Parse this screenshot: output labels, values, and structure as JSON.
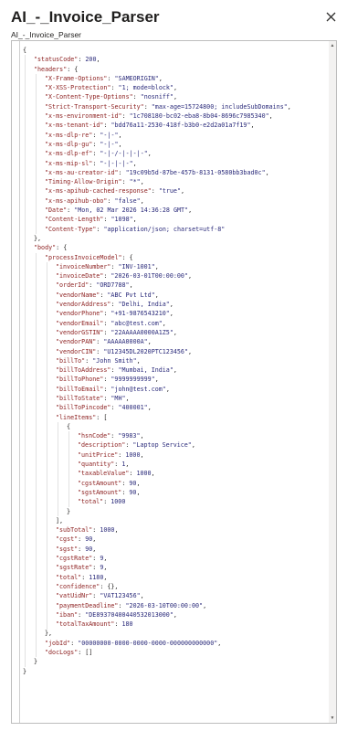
{
  "header": {
    "title": "AI_-_Invoice_Parser",
    "subtitle": "AI_-_Invoice_Parser",
    "close_icon": "close-icon"
  },
  "code_lines": [
    {
      "indent": 0,
      "t": [
        [
          "p",
          "{"
        ]
      ]
    },
    {
      "indent": 1,
      "t": [
        [
          "k",
          "\"statusCode\""
        ],
        [
          "p",
          ": "
        ],
        [
          "n",
          "200"
        ],
        [
          "p",
          ","
        ]
      ]
    },
    {
      "indent": 1,
      "t": [
        [
          "k",
          "\"headers\""
        ],
        [
          "p",
          ": {"
        ]
      ]
    },
    {
      "indent": 2,
      "t": [
        [
          "k",
          "\"X-Frame-Options\""
        ],
        [
          "p",
          ": "
        ],
        [
          "s",
          "\"SAMEORIGIN\""
        ],
        [
          "p",
          ","
        ]
      ]
    },
    {
      "indent": 2,
      "t": [
        [
          "k",
          "\"X-XSS-Protection\""
        ],
        [
          "p",
          ": "
        ],
        [
          "s",
          "\"1; mode=block\""
        ],
        [
          "p",
          ","
        ]
      ]
    },
    {
      "indent": 2,
      "t": [
        [
          "k",
          "\"X-Content-Type-Options\""
        ],
        [
          "p",
          ": "
        ],
        [
          "s",
          "\"nosniff\""
        ],
        [
          "p",
          ","
        ]
      ]
    },
    {
      "indent": 2,
      "t": [
        [
          "k",
          "\"Strict-Transport-Security\""
        ],
        [
          "p",
          ": "
        ],
        [
          "s",
          "\"max-age=15724800; includeSubDomains\""
        ],
        [
          "p",
          ","
        ]
      ]
    },
    {
      "indent": 2,
      "t": [
        [
          "k",
          "\"x-ms-environment-id\""
        ],
        [
          "p",
          ": "
        ],
        [
          "s",
          "\"1c708180-bc02-eba8-8b04-8696c7985340\""
        ],
        [
          "p",
          ","
        ]
      ]
    },
    {
      "indent": 2,
      "t": [
        [
          "k",
          "\"x-ms-tenant-id\""
        ],
        [
          "p",
          ": "
        ],
        [
          "s",
          "\"bdd76a11-2530-418f-b3b0-e2d2a01a7f19\""
        ],
        [
          "p",
          ","
        ]
      ]
    },
    {
      "indent": 2,
      "t": [
        [
          "k",
          "\"x-ms-dlp-re\""
        ],
        [
          "p",
          ": "
        ],
        [
          "s",
          "\"-|-\""
        ],
        [
          "p",
          ","
        ]
      ]
    },
    {
      "indent": 2,
      "t": [
        [
          "k",
          "\"x-ms-dlp-gu\""
        ],
        [
          "p",
          ": "
        ],
        [
          "s",
          "\"-|-\""
        ],
        [
          "p",
          ","
        ]
      ]
    },
    {
      "indent": 2,
      "t": [
        [
          "k",
          "\"x-ms-dlp-ef\""
        ],
        [
          "p",
          ": "
        ],
        [
          "s",
          "\"-|-/-|-|-|-\""
        ],
        [
          "p",
          ","
        ]
      ]
    },
    {
      "indent": 2,
      "t": [
        [
          "k",
          "\"x-ms-mip-sl\""
        ],
        [
          "p",
          ": "
        ],
        [
          "s",
          "\"-|-|-|-\""
        ],
        [
          "p",
          ","
        ]
      ]
    },
    {
      "indent": 2,
      "t": [
        [
          "k",
          "\"x-ms-au-creator-id\""
        ],
        [
          "p",
          ": "
        ],
        [
          "s",
          "\"19c09b5d-87be-457b-8131-0580bb3bad0c\""
        ],
        [
          "p",
          ","
        ]
      ]
    },
    {
      "indent": 2,
      "t": [
        [
          "k",
          "\"Timing-Allow-Origin\""
        ],
        [
          "p",
          ": "
        ],
        [
          "s",
          "\"*\""
        ],
        [
          "p",
          ","
        ]
      ]
    },
    {
      "indent": 2,
      "t": [
        [
          "k",
          "\"x-ms-apihub-cached-response\""
        ],
        [
          "p",
          ": "
        ],
        [
          "s",
          "\"true\""
        ],
        [
          "p",
          ","
        ]
      ]
    },
    {
      "indent": 2,
      "t": [
        [
          "k",
          "\"x-ms-apihub-obo\""
        ],
        [
          "p",
          ": "
        ],
        [
          "s",
          "\"false\""
        ],
        [
          "p",
          ","
        ]
      ]
    },
    {
      "indent": 2,
      "t": [
        [
          "k",
          "\"Date\""
        ],
        [
          "p",
          ": "
        ],
        [
          "s",
          "\"Mon, 02 Mar 2026 14:36:28 GMT\""
        ],
        [
          "p",
          ","
        ]
      ]
    },
    {
      "indent": 2,
      "t": [
        [
          "k",
          "\"Content-Length\""
        ],
        [
          "p",
          ": "
        ],
        [
          "s",
          "\"1098\""
        ],
        [
          "p",
          ","
        ]
      ]
    },
    {
      "indent": 2,
      "t": [
        [
          "k",
          "\"Content-Type\""
        ],
        [
          "p",
          ": "
        ],
        [
          "s",
          "\"application/json; charset=utf-8\""
        ]
      ]
    },
    {
      "indent": 1,
      "t": [
        [
          "p",
          "},"
        ]
      ]
    },
    {
      "indent": 1,
      "t": [
        [
          "k",
          "\"body\""
        ],
        [
          "p",
          ": {"
        ]
      ]
    },
    {
      "indent": 2,
      "t": [
        [
          "k",
          "\"processInvoiceModel\""
        ],
        [
          "p",
          ": {"
        ]
      ]
    },
    {
      "indent": 3,
      "t": [
        [
          "k",
          "\"invoiceNumber\""
        ],
        [
          "p",
          ": "
        ],
        [
          "s",
          "\"INV-1001\""
        ],
        [
          "p",
          ","
        ]
      ]
    },
    {
      "indent": 3,
      "t": [
        [
          "k",
          "\"invoiceDate\""
        ],
        [
          "p",
          ": "
        ],
        [
          "s",
          "\"2026-03-01T00:00:00\""
        ],
        [
          "p",
          ","
        ]
      ]
    },
    {
      "indent": 3,
      "t": [
        [
          "k",
          "\"orderId\""
        ],
        [
          "p",
          ": "
        ],
        [
          "s",
          "\"ORD7788\""
        ],
        [
          "p",
          ","
        ]
      ]
    },
    {
      "indent": 3,
      "t": [
        [
          "k",
          "\"vendorName\""
        ],
        [
          "p",
          ": "
        ],
        [
          "s",
          "\"ABC Pvt Ltd\""
        ],
        [
          "p",
          ","
        ]
      ]
    },
    {
      "indent": 3,
      "t": [
        [
          "k",
          "\"vendorAddress\""
        ],
        [
          "p",
          ": "
        ],
        [
          "s",
          "\"Delhi, India\""
        ],
        [
          "p",
          ","
        ]
      ]
    },
    {
      "indent": 3,
      "t": [
        [
          "k",
          "\"vendorPhone\""
        ],
        [
          "p",
          ": "
        ],
        [
          "s",
          "\"+91-9876543210\""
        ],
        [
          "p",
          ","
        ]
      ]
    },
    {
      "indent": 3,
      "t": [
        [
          "k",
          "\"vendorEmail\""
        ],
        [
          "p",
          ": "
        ],
        [
          "s",
          "\"abc@test.com\""
        ],
        [
          "p",
          ","
        ]
      ]
    },
    {
      "indent": 3,
      "t": [
        [
          "k",
          "\"vendorGSTIN\""
        ],
        [
          "p",
          ": "
        ],
        [
          "s",
          "\"22AAAAA0000A1Z5\""
        ],
        [
          "p",
          ","
        ]
      ]
    },
    {
      "indent": 3,
      "t": [
        [
          "k",
          "\"vendorPAN\""
        ],
        [
          "p",
          ": "
        ],
        [
          "s",
          "\"AAAAA0000A\""
        ],
        [
          "p",
          ","
        ]
      ]
    },
    {
      "indent": 3,
      "t": [
        [
          "k",
          "\"vendorCIN\""
        ],
        [
          "p",
          ": "
        ],
        [
          "s",
          "\"U12345DL2020PTC123456\""
        ],
        [
          "p",
          ","
        ]
      ]
    },
    {
      "indent": 3,
      "t": [
        [
          "k",
          "\"billTo\""
        ],
        [
          "p",
          ": "
        ],
        [
          "s",
          "\"John Smith\""
        ],
        [
          "p",
          ","
        ]
      ]
    },
    {
      "indent": 3,
      "t": [
        [
          "k",
          "\"billToAddress\""
        ],
        [
          "p",
          ": "
        ],
        [
          "s",
          "\"Mumbai, India\""
        ],
        [
          "p",
          ","
        ]
      ]
    },
    {
      "indent": 3,
      "t": [
        [
          "k",
          "\"billToPhone\""
        ],
        [
          "p",
          ": "
        ],
        [
          "s",
          "\"9999999999\""
        ],
        [
          "p",
          ","
        ]
      ]
    },
    {
      "indent": 3,
      "t": [
        [
          "k",
          "\"billToEmail\""
        ],
        [
          "p",
          ": "
        ],
        [
          "s",
          "\"john@test.com\""
        ],
        [
          "p",
          ","
        ]
      ]
    },
    {
      "indent": 3,
      "t": [
        [
          "k",
          "\"billToState\""
        ],
        [
          "p",
          ": "
        ],
        [
          "s",
          "\"MH\""
        ],
        [
          "p",
          ","
        ]
      ]
    },
    {
      "indent": 3,
      "t": [
        [
          "k",
          "\"billToPincode\""
        ],
        [
          "p",
          ": "
        ],
        [
          "s",
          "\"400001\""
        ],
        [
          "p",
          ","
        ]
      ]
    },
    {
      "indent": 3,
      "t": [
        [
          "k",
          "\"lineItems\""
        ],
        [
          "p",
          ": ["
        ]
      ]
    },
    {
      "indent": 4,
      "t": [
        [
          "p",
          "{"
        ]
      ]
    },
    {
      "indent": 5,
      "t": [
        [
          "k",
          "\"hsnCode\""
        ],
        [
          "p",
          ": "
        ],
        [
          "s",
          "\"9983\""
        ],
        [
          "p",
          ","
        ]
      ]
    },
    {
      "indent": 5,
      "t": [
        [
          "k",
          "\"description\""
        ],
        [
          "p",
          ": "
        ],
        [
          "s",
          "\"Laptop Service\""
        ],
        [
          "p",
          ","
        ]
      ]
    },
    {
      "indent": 5,
      "t": [
        [
          "k",
          "\"unitPrice\""
        ],
        [
          "p",
          ": "
        ],
        [
          "n",
          "1000"
        ],
        [
          "p",
          ","
        ]
      ]
    },
    {
      "indent": 5,
      "t": [
        [
          "k",
          "\"quantity\""
        ],
        [
          "p",
          ": "
        ],
        [
          "n",
          "1"
        ],
        [
          "p",
          ","
        ]
      ]
    },
    {
      "indent": 5,
      "t": [
        [
          "k",
          "\"taxableValue\""
        ],
        [
          "p",
          ": "
        ],
        [
          "n",
          "1000"
        ],
        [
          "p",
          ","
        ]
      ]
    },
    {
      "indent": 5,
      "t": [
        [
          "k",
          "\"cgstAmount\""
        ],
        [
          "p",
          ": "
        ],
        [
          "n",
          "90"
        ],
        [
          "p",
          ","
        ]
      ]
    },
    {
      "indent": 5,
      "t": [
        [
          "k",
          "\"sgstAmount\""
        ],
        [
          "p",
          ": "
        ],
        [
          "n",
          "90"
        ],
        [
          "p",
          ","
        ]
      ]
    },
    {
      "indent": 5,
      "t": [
        [
          "k",
          "\"total\""
        ],
        [
          "p",
          ": "
        ],
        [
          "n",
          "1000"
        ]
      ]
    },
    {
      "indent": 4,
      "t": [
        [
          "p",
          "}"
        ]
      ]
    },
    {
      "indent": 3,
      "t": [
        [
          "p",
          "],"
        ]
      ]
    },
    {
      "indent": 3,
      "t": [
        [
          "k",
          "\"subTotal\""
        ],
        [
          "p",
          ": "
        ],
        [
          "n",
          "1000"
        ],
        [
          "p",
          ","
        ]
      ]
    },
    {
      "indent": 3,
      "t": [
        [
          "k",
          "\"cgst\""
        ],
        [
          "p",
          ": "
        ],
        [
          "n",
          "90"
        ],
        [
          "p",
          ","
        ]
      ]
    },
    {
      "indent": 3,
      "t": [
        [
          "k",
          "\"sgst\""
        ],
        [
          "p",
          ": "
        ],
        [
          "n",
          "90"
        ],
        [
          "p",
          ","
        ]
      ]
    },
    {
      "indent": 3,
      "t": [
        [
          "k",
          "\"cgstRate\""
        ],
        [
          "p",
          ": "
        ],
        [
          "n",
          "9"
        ],
        [
          "p",
          ","
        ]
      ]
    },
    {
      "indent": 3,
      "t": [
        [
          "k",
          "\"sgstRate\""
        ],
        [
          "p",
          ": "
        ],
        [
          "n",
          "9"
        ],
        [
          "p",
          ","
        ]
      ]
    },
    {
      "indent": 3,
      "t": [
        [
          "k",
          "\"total\""
        ],
        [
          "p",
          ": "
        ],
        [
          "n",
          "1180"
        ],
        [
          "p",
          ","
        ]
      ]
    },
    {
      "indent": 3,
      "t": [
        [
          "k",
          "\"confidence\""
        ],
        [
          "p",
          ": {},"
        ]
      ]
    },
    {
      "indent": 3,
      "t": [
        [
          "k",
          "\"vatUidNr\""
        ],
        [
          "p",
          ": "
        ],
        [
          "s",
          "\"VAT123456\""
        ],
        [
          "p",
          ","
        ]
      ]
    },
    {
      "indent": 3,
      "t": [
        [
          "k",
          "\"paymentDeadline\""
        ],
        [
          "p",
          ": "
        ],
        [
          "s",
          "\"2026-03-10T00:00:00\""
        ],
        [
          "p",
          ","
        ]
      ]
    },
    {
      "indent": 3,
      "t": [
        [
          "k",
          "\"iban\""
        ],
        [
          "p",
          ": "
        ],
        [
          "s",
          "\"DE89370400440532013000\""
        ],
        [
          "p",
          ","
        ]
      ]
    },
    {
      "indent": 3,
      "t": [
        [
          "k",
          "\"totalTaxAmount\""
        ],
        [
          "p",
          ": "
        ],
        [
          "n",
          "180"
        ]
      ]
    },
    {
      "indent": 2,
      "t": [
        [
          "p",
          "},"
        ]
      ]
    },
    {
      "indent": 2,
      "t": [
        [
          "k",
          "\"jobId\""
        ],
        [
          "p",
          ": "
        ],
        [
          "s",
          "\"00000000-0000-0000-0000-000000000000\""
        ],
        [
          "p",
          ","
        ]
      ]
    },
    {
      "indent": 2,
      "t": [
        [
          "k",
          "\"docLogs\""
        ],
        [
          "p",
          ": []"
        ]
      ]
    },
    {
      "indent": 1,
      "t": [
        [
          "p",
          "}"
        ]
      ]
    },
    {
      "indent": 0,
      "t": [
        [
          "p",
          "}"
        ]
      ]
    }
  ]
}
